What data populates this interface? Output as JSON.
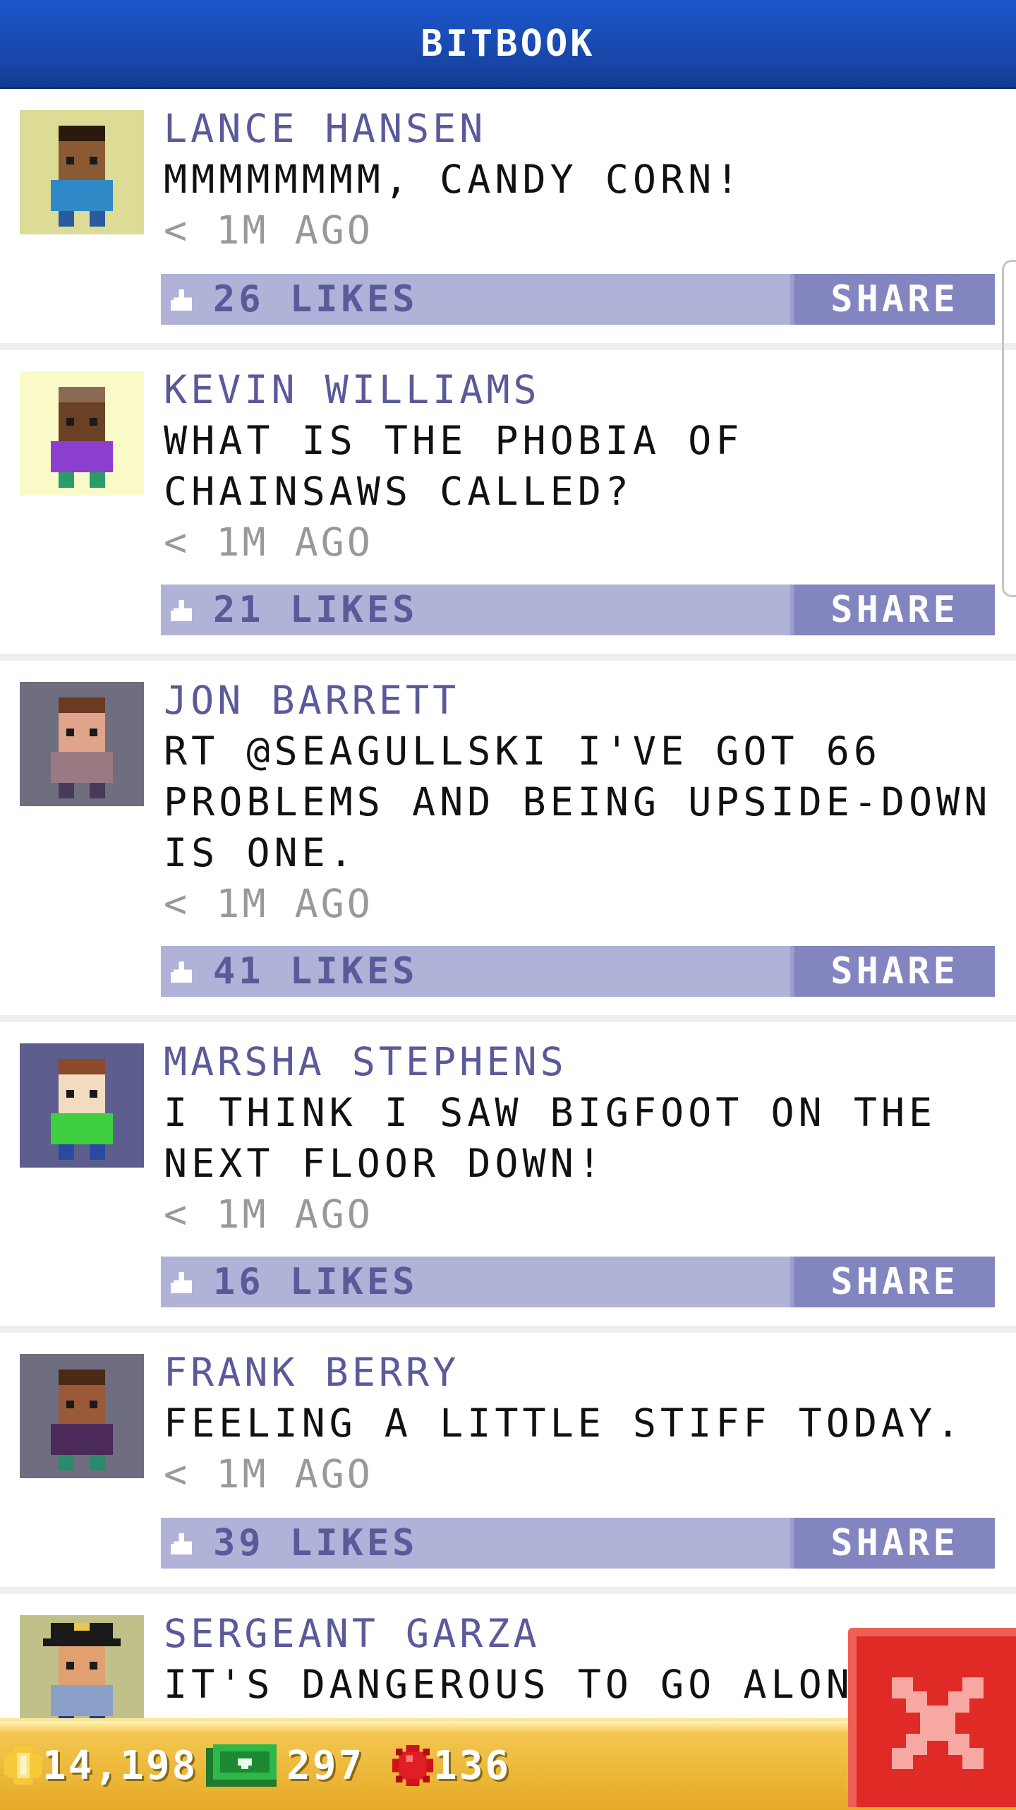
{
  "header": {
    "title": "BITBOOK"
  },
  "feed": {
    "share_label": "SHARE",
    "posts": [
      {
        "author": "LANCE HANSEN",
        "text": "MMMMMMMM, CANDY CORN!",
        "time": "< 1M AGO",
        "likes": "26 LIKES",
        "avatar": {
          "icon": "bitizen-avatar",
          "background": "#dcdc96",
          "skin": "#8a5a35",
          "hair": "#2a1a0e",
          "shirt": "#2f89c7",
          "pants": "#2a5aa0"
        }
      },
      {
        "author": "KEVIN WILLIAMS",
        "text": "WHAT IS THE PHOBIA OF CHAINSAWS CALLED?",
        "time": "< 1M AGO",
        "likes": "21 LIKES",
        "avatar": {
          "icon": "bitizen-avatar",
          "background": "#fafac8",
          "skin": "#6a4125",
          "hair": "#8a6a52",
          "shirt": "#8a3fcf",
          "pants": "#2c9a6a"
        }
      },
      {
        "author": "JON BARRETT",
        "text": "RT @SEAGULLSKI I'VE GOT 66 PROBLEMS AND BEING UPSIDE-DOWN IS ONE.",
        "time": "< 1M AGO",
        "likes": "41 LIKES",
        "avatar": {
          "icon": "bitizen-avatar",
          "background": "#6e6e7e",
          "skin": "#e0a48a",
          "hair": "#6a3a22",
          "shirt": "#9a7a82",
          "pants": "#4a3a5a"
        }
      },
      {
        "author": "MARSHA STEPHENS",
        "text": "I THINK I SAW BIGFOOT ON THE NEXT FLOOR DOWN!",
        "time": "< 1M AGO",
        "likes": "16 LIKES",
        "avatar": {
          "icon": "bitizen-avatar",
          "background": "#5e5e8e",
          "skin": "#f2dcc0",
          "hair": "#8a4a2a",
          "shirt": "#3fcf3f",
          "pants": "#2a4aa0"
        }
      },
      {
        "author": "FRANK BERRY",
        "text": "FEELING A LITTLE STIFF TODAY.",
        "time": "< 1M AGO",
        "likes": "39 LIKES",
        "avatar": {
          "icon": "bitizen-avatar",
          "background": "#6e6e80",
          "skin": "#9a5a3a",
          "hair": "#4a2a14",
          "shirt": "#4a2a5a",
          "pants": "#2a8a6a"
        }
      },
      {
        "author": "SERGEANT GARZA",
        "text": "IT'S DANGEROUS TO GO ALONE, T",
        "time": "",
        "likes": "",
        "avatar": {
          "icon": "police-bitizen-avatar",
          "background": "#c0c08a",
          "skin": "#e0a070",
          "hair": "#1a1a1a",
          "shirt": "#8aa0c8",
          "pants": "#2a3a7a"
        }
      }
    ]
  },
  "resources": {
    "coins": {
      "icon": "coin-icon",
      "value": "14,198"
    },
    "bux": {
      "icon": "bux-icon",
      "value": "297"
    },
    "gems": {
      "icon": "red-gem-icon",
      "value": "136"
    }
  },
  "close_button": {
    "icon": "close-x-icon",
    "color": "#e02a25"
  },
  "colors": {
    "header": "#1846a8",
    "name": "#5a5a9a",
    "likes_bar": "#b0b2d8",
    "share": "#8285bf",
    "bar_gold": "#e6aa26"
  }
}
